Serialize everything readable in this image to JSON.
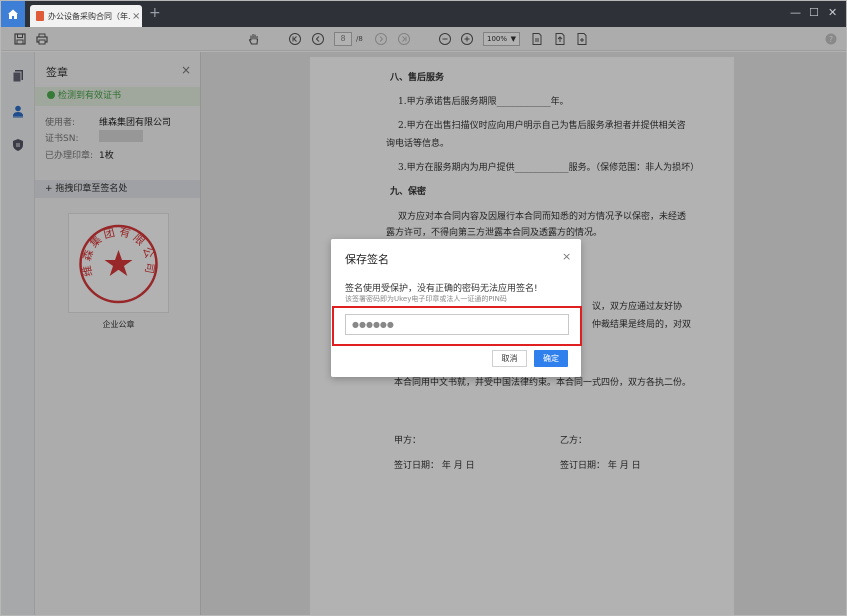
{
  "tab": {
    "title": "办公设备采购合同（年...",
    "close": "×"
  },
  "new_tab": "+",
  "window_controls": {
    "minimize": "—",
    "maximize": "☐",
    "close": "✕"
  },
  "toolbar": {
    "page_input": "8",
    "page_total": "/8",
    "zoom": "100%"
  },
  "panel": {
    "title": "签章",
    "close": "×",
    "cert_status": "检测到有效证书",
    "user_label": "使用者:",
    "user_value": "维森集团有限公司",
    "sn_label": "证书SN:",
    "count_label": "已办理印章:",
    "count_value": "1枚",
    "drag_hint": "拖拽印章至签名处",
    "seal_name": "企业公章",
    "seal_text": "维森集团有限公司"
  },
  "document": {
    "lines": [
      "八、售后服务",
      "1.甲方承诺售后服务期限____________年。",
      "2.甲方在出售扫描仪时应向用户明示自己为售后服务承担者并提供相关咨",
      "询电话等信息。",
      "3.甲方在服务期内为用户提供____________服务。（保修范围：非人为损坏）",
      "九、保密",
      "双方应对本合同内容及因履行本合同而知悉的对方情况予以保密，未经透",
      "露方许可，不得向第三方泄露本合同及透露方的情况。",
      "议，双方应通过友好协",
      "仲裁结果是终局的，对双",
      "本合同用中文书就，并受中国法律约束。本合同一式四份，双方各执二份。",
      "甲方：",
      "乙方：",
      "签订日期：   年    月    日",
      "签订日期：   年    月    日"
    ]
  },
  "modal": {
    "title": "保存签名",
    "close": "×",
    "message": "签名使用受保护，没有正确的密码无法应用签名!",
    "hint": "该签署密码即为Ukey电子印章或法人一证通的PIN码",
    "password_value": "●●●●●●",
    "cancel": "取消",
    "confirm": "确定"
  },
  "colors": {
    "accent": "#2f80ed",
    "titlebar": "#2e3138",
    "seal_red": "#d9383a",
    "highlight": "#e02020",
    "cert_green": "#48a048"
  }
}
